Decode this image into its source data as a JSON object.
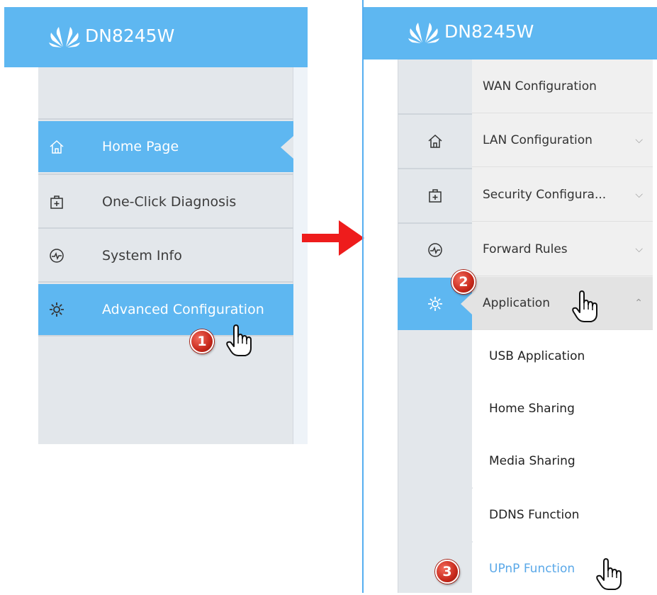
{
  "left_panel": {
    "logo_text": "DN8245W",
    "nav": [
      {
        "label": "Home Page",
        "icon": "home-icon",
        "active": true
      },
      {
        "label": "One-Click Diagnosis",
        "icon": "first-aid-icon",
        "active": false
      },
      {
        "label": "System Info",
        "icon": "activity-icon",
        "active": false
      },
      {
        "label": "Advanced Configuration",
        "icon": "gear-icon",
        "active": true
      }
    ]
  },
  "right_panel": {
    "logo_text": "DN8245W",
    "menu": [
      {
        "label": "WAN Configuration",
        "chevron": ""
      },
      {
        "label": "LAN Configuration",
        "chevron": "down"
      },
      {
        "label": "Security Configura...",
        "chevron": "down"
      },
      {
        "label": "Forward Rules",
        "chevron": "down"
      },
      {
        "label": "Application",
        "chevron": "up"
      }
    ],
    "submenu": [
      {
        "label": "USB Application"
      },
      {
        "label": "Home Sharing"
      },
      {
        "label": "Media Sharing"
      },
      {
        "label": "DDNS Function"
      },
      {
        "label": "UPnP Function",
        "selected": true
      }
    ]
  },
  "steps": [
    "1",
    "2",
    "3"
  ],
  "colors": {
    "header_blue": "#5eb7f1",
    "nav_bg": "#e3e7eb",
    "selected_text": "#5aa8e8",
    "arrow_red": "#ee1c1c"
  }
}
